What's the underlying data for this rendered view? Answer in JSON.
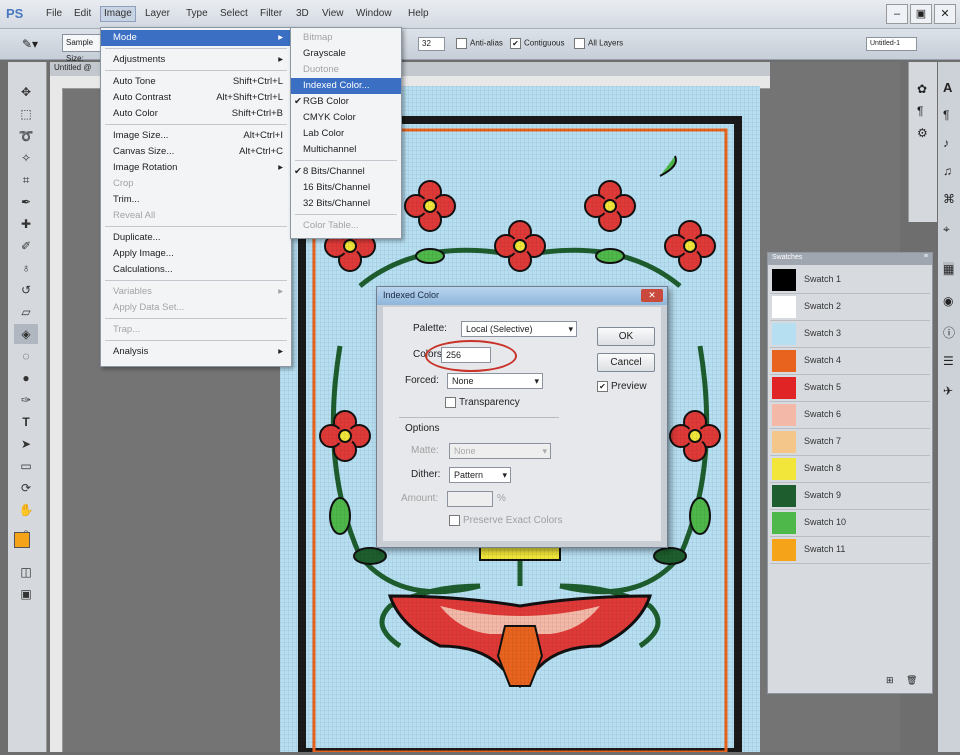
{
  "menubar": {
    "logo": "PS",
    "items": [
      "File",
      "Edit",
      "Image",
      "Layer",
      "Type",
      "Select",
      "Filter",
      "3D",
      "View",
      "Window",
      "Help"
    ],
    "window_controls": [
      "–",
      "▣",
      "✕"
    ]
  },
  "optbar": {
    "sample_label": "Sample Size:",
    "tolerance": "32",
    "anti_alias": "Anti-alias",
    "contiguous": "Contiguous",
    "all_layers": "All Layers",
    "doc_name": "Untitled-1"
  },
  "doc_tab": "Untitled @",
  "image_menu": {
    "items": [
      {
        "label": "Mode",
        "shortcut": "",
        "arrow": "▸",
        "state": "hl"
      },
      {
        "label": "Adjustments",
        "shortcut": "",
        "arrow": "▸",
        "state": ""
      },
      {
        "label": "Auto Tone",
        "shortcut": "Shift+Ctrl+L",
        "arrow": "",
        "state": ""
      },
      {
        "label": "Auto Contrast",
        "shortcut": "Alt+Shift+Ctrl+L",
        "arrow": "",
        "state": ""
      },
      {
        "label": "Auto Color",
        "shortcut": "Shift+Ctrl+B",
        "arrow": "",
        "state": ""
      },
      {
        "label": "Image Size...",
        "shortcut": "Alt+Ctrl+I",
        "arrow": "",
        "state": ""
      },
      {
        "label": "Canvas Size...",
        "shortcut": "Alt+Ctrl+C",
        "arrow": "",
        "state": ""
      },
      {
        "label": "Image Rotation",
        "shortcut": "",
        "arrow": "▸",
        "state": ""
      },
      {
        "label": "Crop",
        "shortcut": "",
        "arrow": "",
        "state": "dis"
      },
      {
        "label": "Trim...",
        "shortcut": "",
        "arrow": "",
        "state": ""
      },
      {
        "label": "Reveal All",
        "shortcut": "",
        "arrow": "",
        "state": "dis"
      },
      {
        "label": "Duplicate...",
        "shortcut": "",
        "arrow": "",
        "state": ""
      },
      {
        "label": "Apply Image...",
        "shortcut": "",
        "arrow": "",
        "state": ""
      },
      {
        "label": "Calculations...",
        "shortcut": "",
        "arrow": "",
        "state": ""
      },
      {
        "label": "Variables",
        "shortcut": "",
        "arrow": "▸",
        "state": "dis"
      },
      {
        "label": "Apply Data Set...",
        "shortcut": "",
        "arrow": "",
        "state": "dis"
      },
      {
        "label": "Trap...",
        "shortcut": "",
        "arrow": "",
        "state": "dis"
      },
      {
        "label": "Analysis",
        "shortcut": "",
        "arrow": "▸",
        "state": ""
      }
    ]
  },
  "mode_submenu": {
    "items": [
      {
        "label": "Bitmap",
        "check": "",
        "state": "dis"
      },
      {
        "label": "Grayscale",
        "check": "",
        "state": ""
      },
      {
        "label": "Duotone",
        "check": "",
        "state": "dis"
      },
      {
        "label": "Indexed Color...",
        "check": "",
        "state": "hl"
      },
      {
        "label": "RGB Color",
        "check": "✔",
        "state": ""
      },
      {
        "label": "CMYK Color",
        "check": "",
        "state": ""
      },
      {
        "label": "Lab Color",
        "check": "",
        "state": ""
      },
      {
        "label": "Multichannel",
        "check": "",
        "state": ""
      },
      {
        "label": "8 Bits/Channel",
        "check": "✔",
        "state": ""
      },
      {
        "label": "16 Bits/Channel",
        "check": "",
        "state": ""
      },
      {
        "label": "32 Bits/Channel",
        "check": "",
        "state": ""
      },
      {
        "label": "Color Table...",
        "check": "",
        "state": "dis"
      }
    ]
  },
  "dialog": {
    "title": "Indexed Color",
    "palette_label": "Palette:",
    "palette_value": "Local (Selective)",
    "colors_label": "Colors:",
    "colors_value": "256",
    "forced_label": "Forced:",
    "forced_value": "None",
    "transparency_label": "Transparency",
    "options_label": "Options",
    "matte_label": "Matte:",
    "matte_value": "None",
    "dither_label": "Dither:",
    "dither_value": "Pattern",
    "amount_label": "Amount:",
    "amount_unit": "%",
    "preserve_label": "Preserve Exact Colors",
    "ok": "OK",
    "cancel": "Cancel",
    "preview": "Preview",
    "highlight_color": "#c8332a"
  },
  "swatches_panel": {
    "title": "Swatches",
    "items": [
      {
        "name": "Swatch 1",
        "color": "#000000"
      },
      {
        "name": "Swatch 2",
        "color": "#ffffff"
      },
      {
        "name": "Swatch 3",
        "color": "#b7dff2"
      },
      {
        "name": "Swatch 4",
        "color": "#e8641e"
      },
      {
        "name": "Swatch 5",
        "color": "#e02426"
      },
      {
        "name": "Swatch 6",
        "color": "#f4b8a8"
      },
      {
        "name": "Swatch 7",
        "color": "#f5c68a"
      },
      {
        "name": "Swatch 8",
        "color": "#f2e63a"
      },
      {
        "name": "Swatch 9",
        "color": "#1e5e2e"
      },
      {
        "name": "Swatch 10",
        "color": "#4fb84a"
      },
      {
        "name": "Swatch 11",
        "color": "#f5a41a"
      }
    ]
  },
  "tool_icons": [
    "move-icon",
    "marquee-icon",
    "lasso-icon",
    "quick-select-icon",
    "crop-icon",
    "eyedropper-icon",
    "healing-icon",
    "brush-icon",
    "clone-stamp-icon",
    "history-brush-icon",
    "eraser-icon",
    "paint-bucket-icon",
    "blur-icon",
    "dodge-icon",
    "pen-icon",
    "type-icon",
    "path-select-icon",
    "shape-icon",
    "3d-rotate-icon",
    "hand-icon",
    "zoom-icon"
  ],
  "colors": {
    "foreground": "#f5a41a",
    "background": "#ffffff"
  }
}
